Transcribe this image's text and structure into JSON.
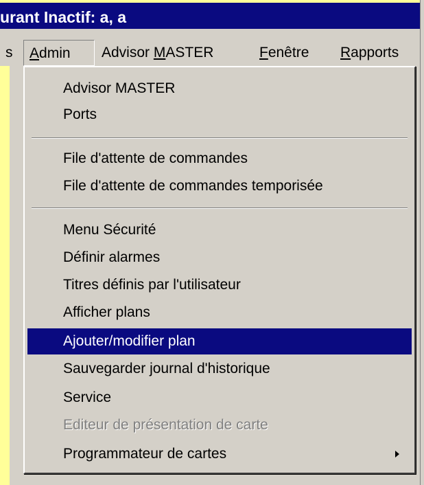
{
  "window": {
    "title": "urant Inactif: a, a"
  },
  "menubar": {
    "items": [
      {
        "label": "s"
      },
      {
        "label": "Admin"
      },
      {
        "label": "Advisor MASTER"
      },
      {
        "label": "Fenêtre"
      },
      {
        "label": "Rapports"
      }
    ]
  },
  "dropdown": {
    "items": [
      {
        "label": "Advisor MASTER"
      },
      {
        "label": "Ports"
      },
      {
        "label": "File d'attente de commandes"
      },
      {
        "label": "File d'attente de commandes temporisée"
      },
      {
        "label": "Menu Sécurité"
      },
      {
        "label": "Définir alarmes"
      },
      {
        "label": "Titres définis par l'utilisateur"
      },
      {
        "label": "Afficher plans"
      },
      {
        "label": "Ajouter/modifier plan",
        "state": "selected"
      },
      {
        "label": "Sauvegarder journal d'historique"
      },
      {
        "label": "Service"
      },
      {
        "label": "Editeur de présentation de carte",
        "state": "disabled"
      },
      {
        "label": "Programmateur de cartes",
        "has_submenu": true
      }
    ]
  },
  "colors": {
    "title_bar": "#0a0a80",
    "selection": "#0a0a80",
    "menu_face": "#d4d0c8",
    "background": "#ffff99",
    "disabled_text": "#808080"
  }
}
